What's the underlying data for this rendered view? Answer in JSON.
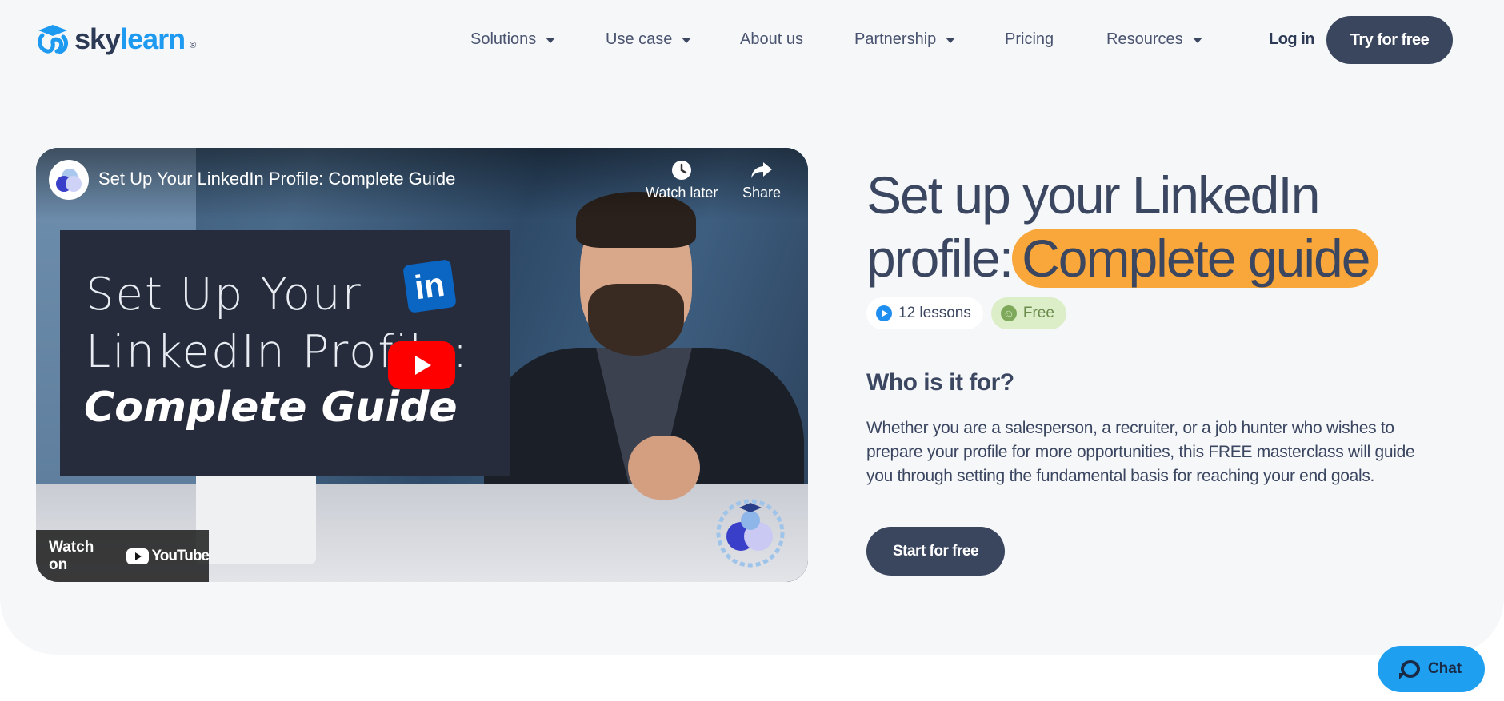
{
  "brand": {
    "name_part1": "sky",
    "name_part2": "learn",
    "registered": "®",
    "accent_color": "#1e9af0",
    "logo_icon": "skylearn-cap-logo-icon"
  },
  "nav": {
    "items": [
      {
        "label": "Solutions",
        "has_dropdown": true
      },
      {
        "label": "Use case",
        "has_dropdown": true
      },
      {
        "label": "About us",
        "has_dropdown": false
      },
      {
        "label": "Partnership",
        "has_dropdown": true
      },
      {
        "label": "Pricing",
        "has_dropdown": false
      },
      {
        "label": "Resources",
        "has_dropdown": true
      }
    ],
    "login_label": "Log in",
    "try_label": "Try for free"
  },
  "video": {
    "title": "Set Up Your LinkedIn Profile: Complete Guide",
    "watch_later_label": "Watch later",
    "share_label": "Share",
    "thumbnail_line1": "Set Up Your",
    "thumbnail_line2": "LinkedIn Profile:",
    "thumbnail_line3": "Complete Guide",
    "linkedin_badge": "in",
    "watch_on_label": "Watch on",
    "youtube_label": "YouTube"
  },
  "course": {
    "title_line1": "Set up your LinkedIn",
    "title_line2_plain": "profile:",
    "title_line2_highlight": "Complete guide",
    "highlight_color": "#f9a63a",
    "lessons_label": "12 lessons",
    "price_label": "Free",
    "who_heading": "Who is it for?",
    "description": "Whether you are a salesperson, a recruiter, or a job hunter who wishes to prepare your profile for more opportunities, this FREE masterclass will guide you through setting the fundamental basis for reaching your end goals.",
    "cta_label": "Start for free",
    "button_color": "#3a465e"
  },
  "chat": {
    "label": "Chat",
    "color": "#1e9ff0"
  }
}
